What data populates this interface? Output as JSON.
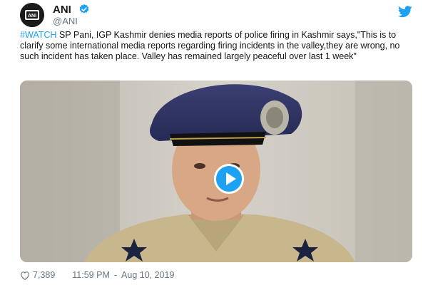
{
  "tweet": {
    "display_name": "ANI",
    "handle": "@ANI",
    "avatar_icon": "ani-logo-icon",
    "verified_icon": "verified-badge-icon",
    "platform_icon": "twitter-bird-icon",
    "hashtag": "#WATCH",
    "text": " SP Pani, IGP Kashmir denies media reports of police firing in Kashmir says,\"This is to clarify some international media reports regarding firing incidents in the valley,they are wrong, no such incident has taken place. Valley has remained largely peaceful over last 1 week\"",
    "likes": "7,389",
    "time": "11:59 PM",
    "separator": "-",
    "date": "Aug 10, 2019",
    "accent_color": "#1da1f2"
  },
  "video": {
    "play_icon": "play-icon"
  }
}
